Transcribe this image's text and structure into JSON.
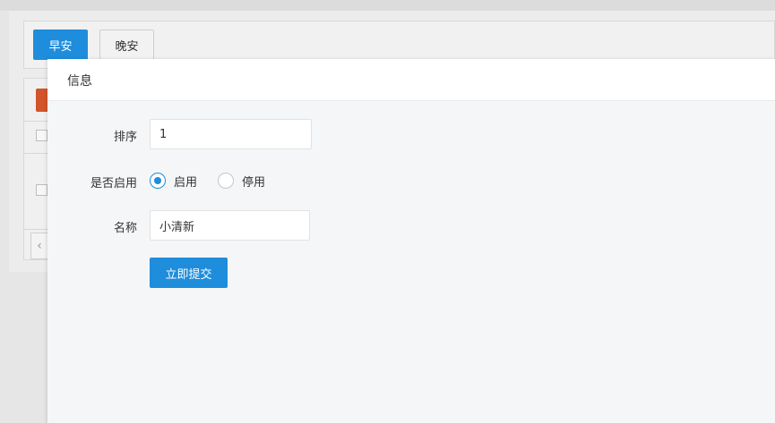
{
  "background": {
    "tabs": {
      "primary_label": "早安",
      "secondary_label": "晚安"
    }
  },
  "modal": {
    "title": "信息",
    "form": {
      "sort_label": "排序",
      "sort_value": "1",
      "enable_label": "是否启用",
      "enable_options": [
        "启用",
        "停用"
      ],
      "enable_selected": "启用",
      "name_label": "名称",
      "name_value": "小清新",
      "submit_label": "立即提交"
    }
  },
  "colors": {
    "accent": "#1e8ddc",
    "danger": "#d2542a",
    "modal_bg": "#f5f6f8"
  }
}
